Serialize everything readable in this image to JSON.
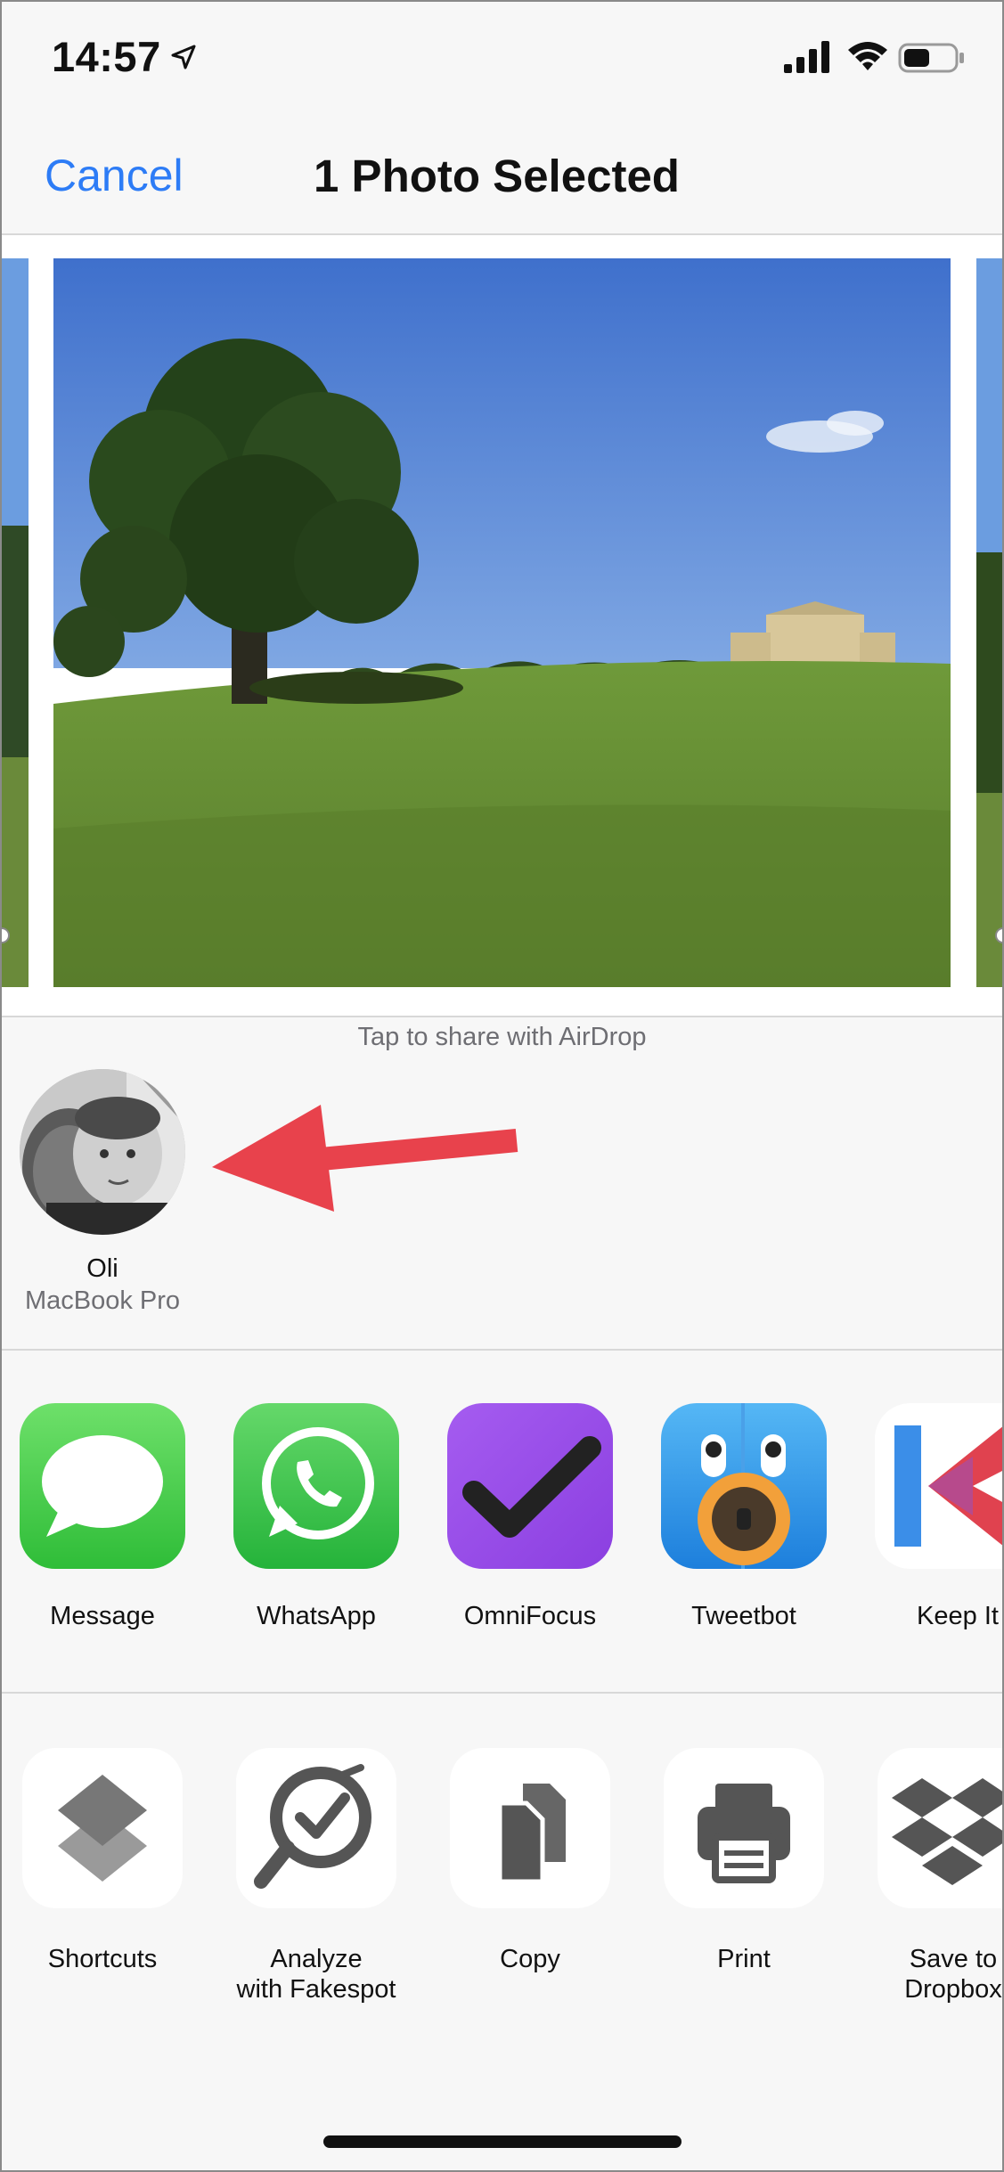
{
  "status": {
    "time": "14:57"
  },
  "nav": {
    "cancel_label": "Cancel",
    "title": "1 Photo Selected"
  },
  "airdrop": {
    "caption": "Tap to share with AirDrop",
    "contact": {
      "name": "Oli",
      "device": "MacBook Pro"
    }
  },
  "apps": [
    {
      "label": "Message",
      "icon": "messages-icon"
    },
    {
      "label": "WhatsApp",
      "icon": "whatsapp-icon"
    },
    {
      "label": "OmniFocus",
      "icon": "omnifocus-icon"
    },
    {
      "label": "Tweetbot",
      "icon": "tweetbot-icon"
    },
    {
      "label": "Keep It",
      "icon": "keep-it-icon"
    }
  ],
  "actions": [
    {
      "label": "Shortcuts",
      "icon": "shortcuts-icon"
    },
    {
      "label_line1": "Analyze",
      "label_line2": "with Fakespot",
      "icon": "fakespot-icon"
    },
    {
      "label": "Copy",
      "icon": "copy-icon"
    },
    {
      "label": "Print",
      "icon": "print-icon"
    },
    {
      "label_line1": "Save to",
      "label_line2": "Dropbox",
      "icon": "dropbox-icon"
    }
  ],
  "colors": {
    "accent": "#2d7cf6",
    "annotation_arrow": "#e8424c",
    "selected_check": "#2d6cdf"
  }
}
